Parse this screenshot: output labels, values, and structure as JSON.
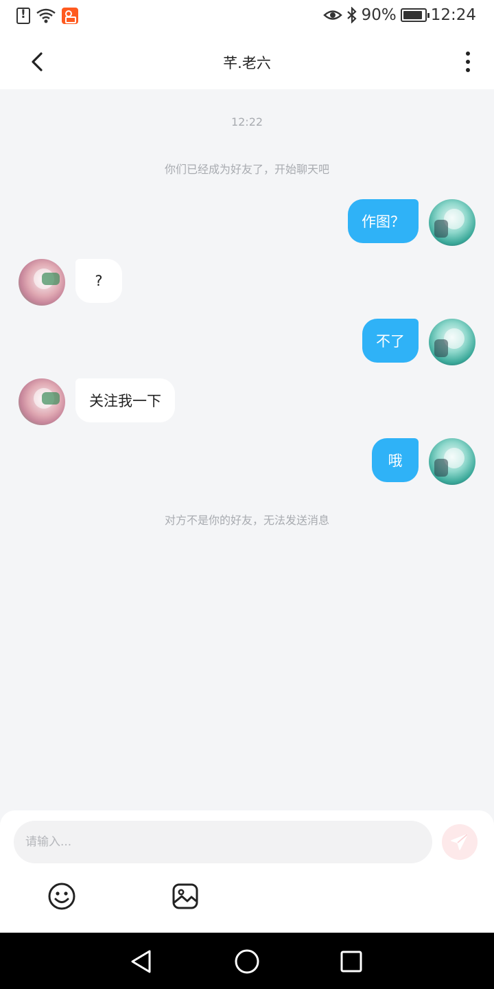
{
  "status_bar": {
    "battery_percent": "90%",
    "time": "12:24",
    "battery_level": 0.9
  },
  "header": {
    "title": "芊.老六"
  },
  "chat": {
    "time_label": "12:22",
    "friend_note": "你们已经成为好友了，开始聊天吧",
    "messages": [
      {
        "sender": "me",
        "text": "作图？"
      },
      {
        "sender": "peer",
        "text": "?"
      },
      {
        "sender": "me",
        "text": "不了"
      },
      {
        "sender": "peer",
        "text": "关注我一下"
      },
      {
        "sender": "me",
        "text": "哦"
      }
    ],
    "blocked_note": "对方不是你的好友，无法发送消息"
  },
  "input": {
    "placeholder": "请输入..."
  },
  "colors": {
    "my_bubble": "#2fb2f7",
    "peer_bubble": "#ffffff",
    "chat_background": "#f4f5f7",
    "send_button": "#fde9ea"
  }
}
